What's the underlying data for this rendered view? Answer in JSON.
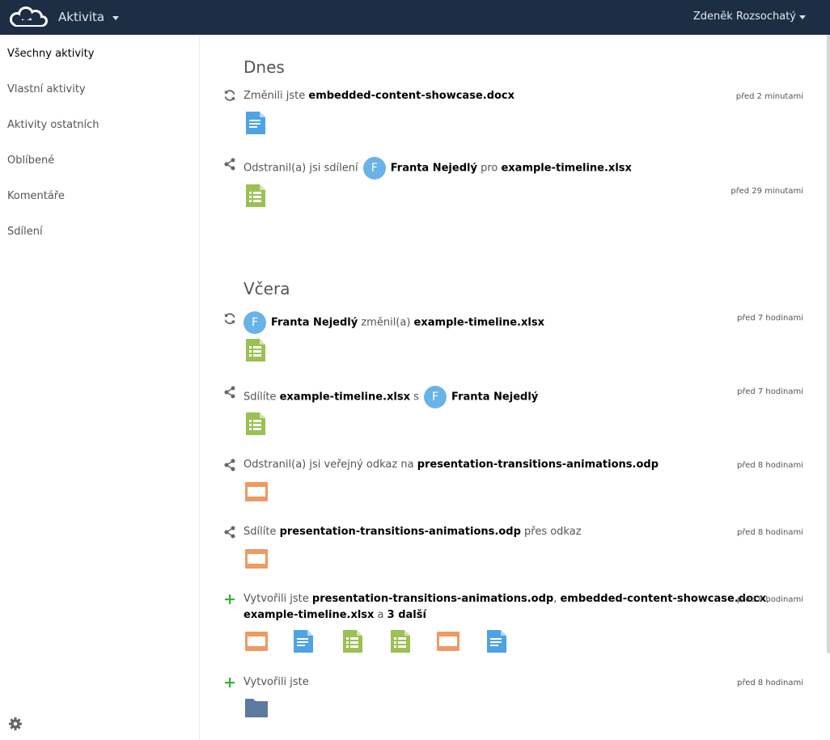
{
  "header": {
    "app_name": "Aktivita",
    "user_name": "Zdeněk Rozsochatý"
  },
  "sidebar": {
    "items": [
      {
        "label": "Všechny aktivity"
      },
      {
        "label": "Vlastní aktivity"
      },
      {
        "label": "Aktivity ostatních"
      },
      {
        "label": "Oblíbené"
      },
      {
        "label": "Komentáře"
      },
      {
        "label": "Sdílení"
      }
    ]
  },
  "sections": {
    "today": "Dnes",
    "yesterday": "Včera"
  },
  "activities": [
    {
      "icon": "sync-icon",
      "p1": "Změnili jste ",
      "b1": "embedded-content-showcase.docx",
      "time": "před 2 minutami"
    },
    {
      "icon": "share-icon",
      "p1": "Odstranil(a) jsi sdílení ",
      "avatar": "F",
      "b1": "Franta Nejedlý",
      "p2": " pro ",
      "b2": "example-timeline.xlsx",
      "time": "před 29 minutami"
    },
    {
      "icon": "sync-icon",
      "avatar": "F",
      "b1": "Franta Nejedlý",
      "p1": " změnil(a) ",
      "b2": "example-timeline.xlsx",
      "time": "před 7 hodinami"
    },
    {
      "icon": "share-icon",
      "p1": "Sdílíte ",
      "b1": "example-timeline.xlsx",
      "p2": " s ",
      "avatar": "F",
      "b2": "Franta Nejedlý",
      "time": "před 7 hodinami"
    },
    {
      "icon": "share-icon",
      "p1": "Odstranil(a) jsi veřejný odkaz na ",
      "b1": "presentation-transitions-animations.odp",
      "time": "před 8 hodinami"
    },
    {
      "icon": "share-icon",
      "p1": "Sdílíte ",
      "b1": "presentation-transitions-animations.odp",
      "p2": " přes odkaz",
      "time": "před 8 hodinami"
    },
    {
      "icon": "plus-icon",
      "p1": "Vytvořili jste ",
      "b1": "presentation-transitions-animations.odp",
      "p2": ", ",
      "b2": "embedded-content-showcase.docx",
      "p3": ",",
      "b3": "example-timeline.xlsx",
      "p4": " a ",
      "b4": "3 další",
      "time": "před 8 hodinami"
    },
    {
      "icon": "plus-icon",
      "p1": "Vytvořili jste",
      "time": "před 8 hodinami"
    }
  ],
  "colors": {
    "header_bg": "#1d2d44",
    "doc": "#4da3e4",
    "sheet": "#9bc054",
    "presentation": "#ee9a63",
    "folder": "#5c7aa0",
    "plus": "#35b532"
  }
}
